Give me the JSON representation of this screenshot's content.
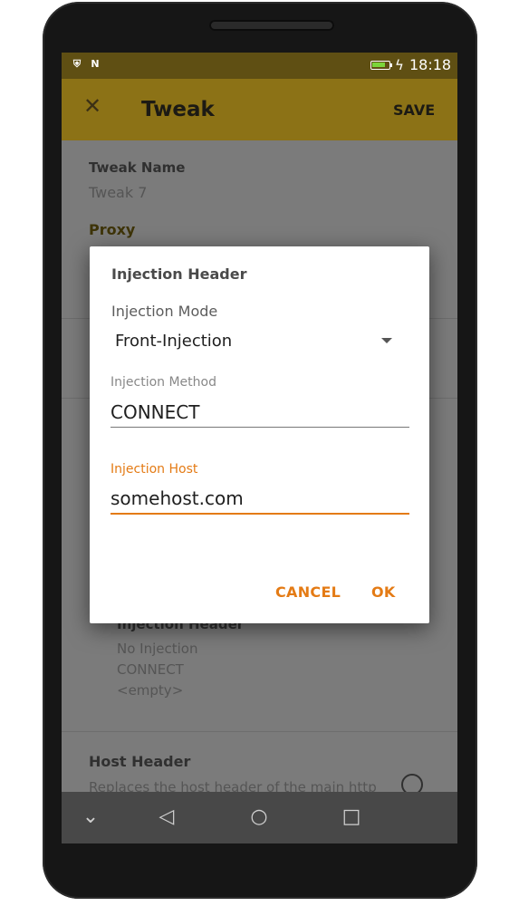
{
  "status_bar": {
    "time": "18:18",
    "icons": [
      "shield-icon",
      "n-icon",
      "battery-icon",
      "charging-icon"
    ],
    "battery_level": 0.85
  },
  "app_bar": {
    "title": "Tweak",
    "save_label": "SAVE",
    "close_icon": "close-icon"
  },
  "form": {
    "tweak_name_label": "Tweak Name",
    "tweak_name_value": "Tweak 7",
    "proxy_section": "Proxy",
    "injection_header_label": "Injection Header",
    "injection_header_lines": [
      "No Injection",
      "CONNECT",
      "<empty>"
    ],
    "host_header_label": "Host Header",
    "host_header_desc": "Replaces the host header of the main http"
  },
  "dialog": {
    "title": "Injection Header",
    "mode_label": "Injection Mode",
    "mode_value": "Front-Injection",
    "method_label": "Injection Method",
    "method_value": "CONNECT",
    "host_label": "Injection Host",
    "host_value": "somehost.com",
    "cancel_label": "CANCEL",
    "ok_label": "OK"
  },
  "colors": {
    "app_bar": "#8c7216",
    "status_bar": "#5f4f13",
    "accent": "#e47b15"
  },
  "nav_bar": {
    "icons": [
      "chevron-down-icon",
      "back-icon",
      "home-icon",
      "recents-icon"
    ]
  }
}
